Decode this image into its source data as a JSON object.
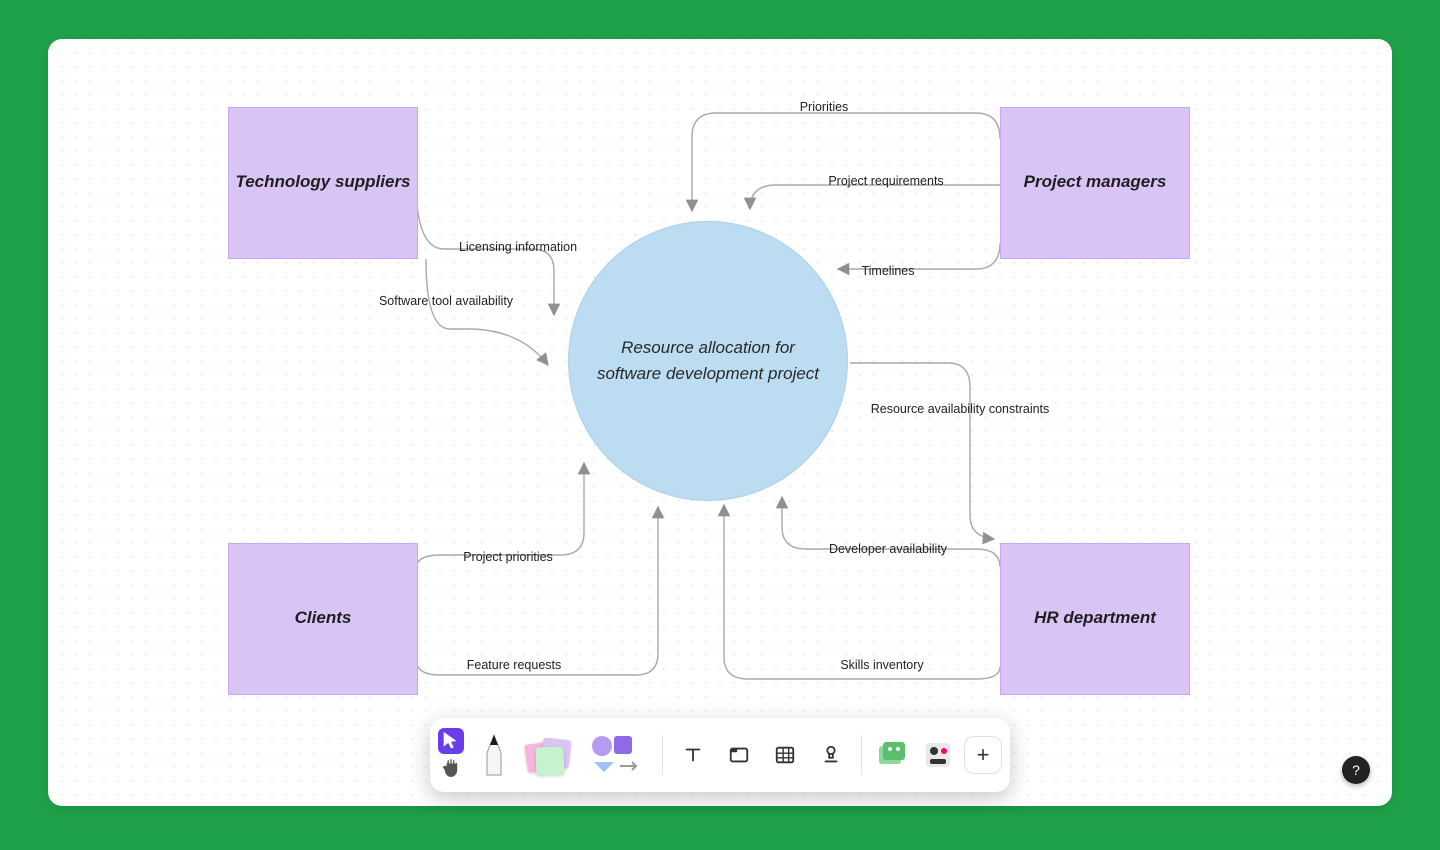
{
  "accent": "#6a3de8",
  "nodes": {
    "tech_suppliers": "Technology suppliers",
    "project_managers": "Project managers",
    "clients": "Clients",
    "hr": "HR department",
    "center": "Resource allocation for software development project"
  },
  "edges": {
    "priorities": "Priorities",
    "project_requirements": "Project requirements",
    "timelines": "Timelines",
    "licensing_info": "Licensing information",
    "software_availability": "Software tool availability",
    "project_priorities": "Project priorities",
    "feature_requests": "Feature requests",
    "resource_constraints": "Resource availability constraints",
    "developer_availability": "Developer availability",
    "skills_inventory": "Skills inventory"
  },
  "toolbar": {
    "cursor": "Select",
    "hand": "Pan",
    "pen": "Draw",
    "sticky": "Sticky note",
    "shapes": "Shapes",
    "text": "Text",
    "section": "Section",
    "table": "Table",
    "stamp": "Stamp",
    "widgets": "Widgets",
    "more": "More tools",
    "plus": "+"
  },
  "help": "?"
}
